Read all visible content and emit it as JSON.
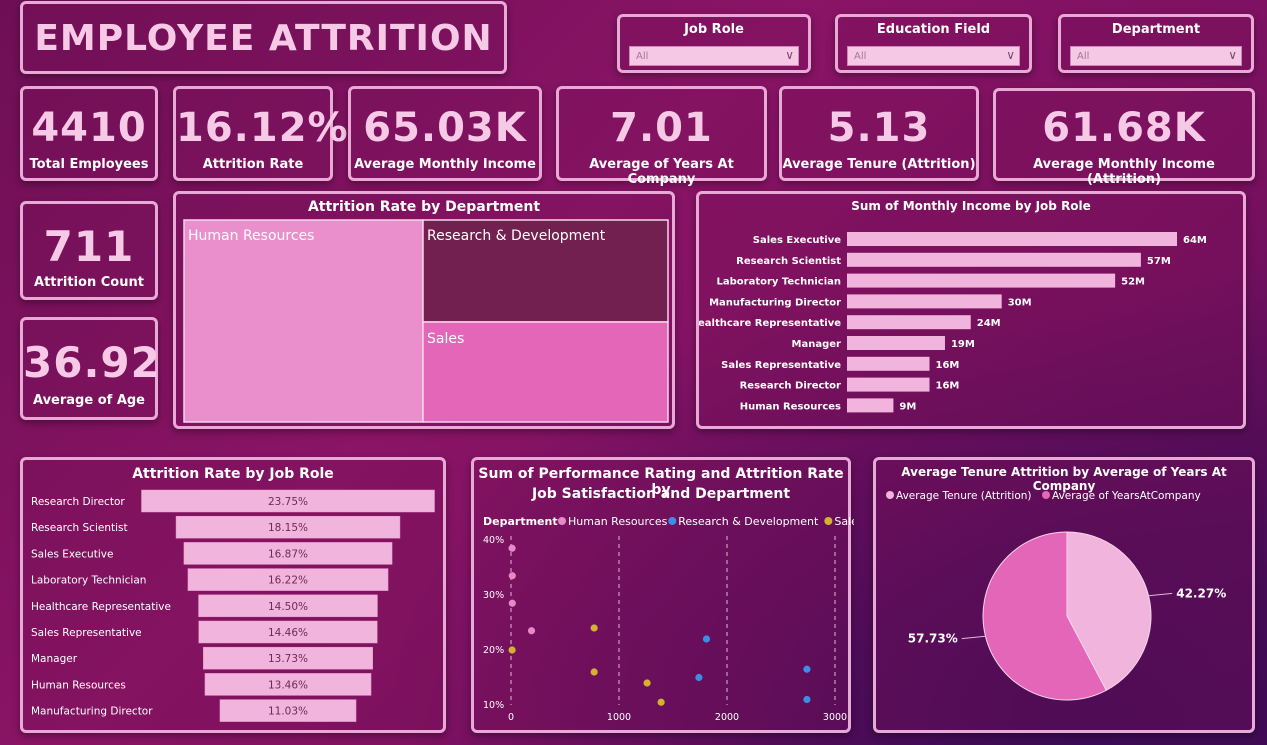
{
  "title": "EMPLOYEE ATTRITION",
  "slicers": [
    {
      "label": "Job Role",
      "value": "All"
    },
    {
      "label": "Education Field",
      "value": "All"
    },
    {
      "label": "Department",
      "value": "All"
    }
  ],
  "kpis": {
    "total_employees": {
      "value": "4410",
      "label": "Total Employees"
    },
    "attrition_rate": {
      "value": "16.12%",
      "label": "Attrition Rate"
    },
    "avg_monthly_income": {
      "value": "65.03K",
      "label": "Average Monthly Income"
    },
    "avg_years_company": {
      "value": "7.01",
      "label": "Average of Years At Company"
    },
    "avg_tenure_attr": {
      "value": "5.13",
      "label": "Average Tenure (Attrition)"
    },
    "avg_income_attr": {
      "value": "61.68K",
      "label": "Average Monthly Income (Attrition)"
    },
    "attrition_count": {
      "value": "711",
      "label": "Attrition Count"
    },
    "avg_age": {
      "value": "36.92",
      "label": "Average of Age"
    }
  },
  "colors": {
    "light_pink": "#f1b4dd",
    "mid_pink": "#e366b8",
    "dark_plum": "#72204f",
    "treemap_hr": "#ea8fcb",
    "blue": "#3a8ee6",
    "gold": "#d4b12e",
    "hr_dot": "#e58ac4"
  },
  "chart_data": [
    {
      "type": "treemap",
      "title": "Attrition Rate by Department",
      "categories": [
        "Human Resources",
        "Research & Development",
        "Sales"
      ]
    },
    {
      "type": "bar",
      "title": "Sum of Monthly Income by Job Role",
      "categories": [
        "Sales Executive",
        "Research Scientist",
        "Laboratory Technician",
        "Manufacturing Director",
        "Healthcare Representative",
        "Manager",
        "Sales Representative",
        "Research Director",
        "Human Resources"
      ],
      "values": [
        64,
        57,
        52,
        30,
        24,
        19,
        16,
        16,
        9
      ],
      "labels": [
        "64M",
        "57M",
        "52M",
        "30M",
        "24M",
        "19M",
        "16M",
        "16M",
        "9M"
      ],
      "orientation": "horizontal"
    },
    {
      "type": "bar",
      "title": "Attrition Rate by Job Role",
      "categories": [
        "Research Director",
        "Research Scientist",
        "Sales Executive",
        "Laboratory Technician",
        "Healthcare Representative",
        "Sales Representative",
        "Manager",
        "Human Resources",
        "Manufacturing Director"
      ],
      "values": [
        23.75,
        18.15,
        16.87,
        16.22,
        14.5,
        14.46,
        13.73,
        13.46,
        11.03
      ],
      "labels": [
        "23.75%",
        "18.15%",
        "16.87%",
        "16.22%",
        "14.50%",
        "14.46%",
        "13.73%",
        "13.46%",
        "11.03%"
      ],
      "orientation": "funnel"
    },
    {
      "type": "scatter",
      "title_line1": "Sum of Performance Rating and Attrition Rate by",
      "title_line2": "Job Satisfaction and Department",
      "legend_title": "Department",
      "series": [
        {
          "name": "Human Resources",
          "color": "#e58ac4",
          "points": [
            [
              10,
              38.5
            ],
            [
              12,
              33.5
            ],
            [
              12,
              28.5
            ],
            [
              190,
              23.5
            ]
          ]
        },
        {
          "name": "Research & Development",
          "color": "#3a8ee6",
          "points": [
            [
              1810,
              22
            ],
            [
              1740,
              15
            ],
            [
              2740,
              16.5
            ],
            [
              2740,
              11
            ]
          ]
        },
        {
          "name": "Sales",
          "color": "#d4b12e",
          "points": [
            [
              10,
              20
            ],
            [
              770,
              24
            ],
            [
              770,
              16
            ],
            [
              1260,
              14
            ],
            [
              1390,
              10.5
            ]
          ]
        }
      ],
      "xticks": [
        "0",
        "1000",
        "2000",
        "3000"
      ],
      "yticks": [
        "40%",
        "30%",
        "20%",
        "10%"
      ],
      "xlim": [
        0,
        3000
      ],
      "ylim": [
        10,
        40
      ]
    },
    {
      "type": "pie",
      "title": "Average Tenure Attrition by Average of Years At Company",
      "legend": [
        "Average Tenure (Attrition)",
        "Average of YearsAtCompany"
      ],
      "values": [
        42.27,
        57.73
      ],
      "labels": [
        "42.27%",
        "57.73%"
      ]
    }
  ]
}
